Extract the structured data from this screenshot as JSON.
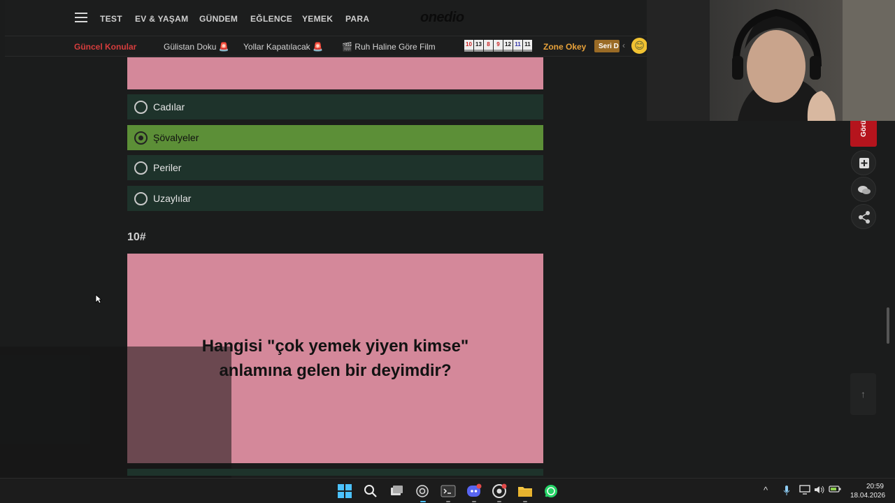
{
  "nav": {
    "items": [
      "TEST",
      "EV & YAŞAM",
      "GÜNDEM",
      "EĞLENCE",
      "YEMEK",
      "PARA"
    ],
    "logo": "onedio"
  },
  "trending": {
    "title": "Güncel Konular",
    "items": [
      {
        "label": "Gülistan Doku",
        "emoji": "🚨"
      },
      {
        "label": "Yollar Kapatılacak",
        "emoji": "🚨"
      },
      {
        "label": "Ruh Haline Göre Film",
        "emoji": "🎬"
      }
    ],
    "game_tiles": [
      "10",
      "13",
      "8",
      "9",
      "12",
      "11",
      "11"
    ],
    "game_name": "Zone Okey",
    "seri_label": "Seri D",
    "smiley": "😊"
  },
  "quiz": {
    "options": [
      {
        "label": "Cadılar",
        "selected": false
      },
      {
        "label": "Şövalyeler",
        "selected": true
      },
      {
        "label": "Periler",
        "selected": false
      },
      {
        "label": "Uzaylılar",
        "selected": false
      }
    ],
    "question_number": "10#",
    "question_line1": "Hangisi \"çok yemek yiyen kimse\"",
    "question_line2": "anlamına gelen bir deyimdir?"
  },
  "rail": {
    "goru_label": "Görü",
    "icons": [
      "bookmark-add-icon",
      "comments-icon",
      "share-icon"
    ],
    "to_top_icon": "↑"
  },
  "taskbar": {
    "apps": [
      "windows-start-icon",
      "search-icon",
      "task-view-icon",
      "obs-icon",
      "terminal-icon",
      "discord-icon",
      "chrome-icon",
      "file-explorer-icon",
      "whatsapp-icon"
    ],
    "time": "20:59",
    "date": "18.04.2026"
  },
  "colors": {
    "pink": "#d4889a",
    "option_bg": "#1e332b",
    "selected": "#5c8f37",
    "accent_red": "#b5141d"
  }
}
